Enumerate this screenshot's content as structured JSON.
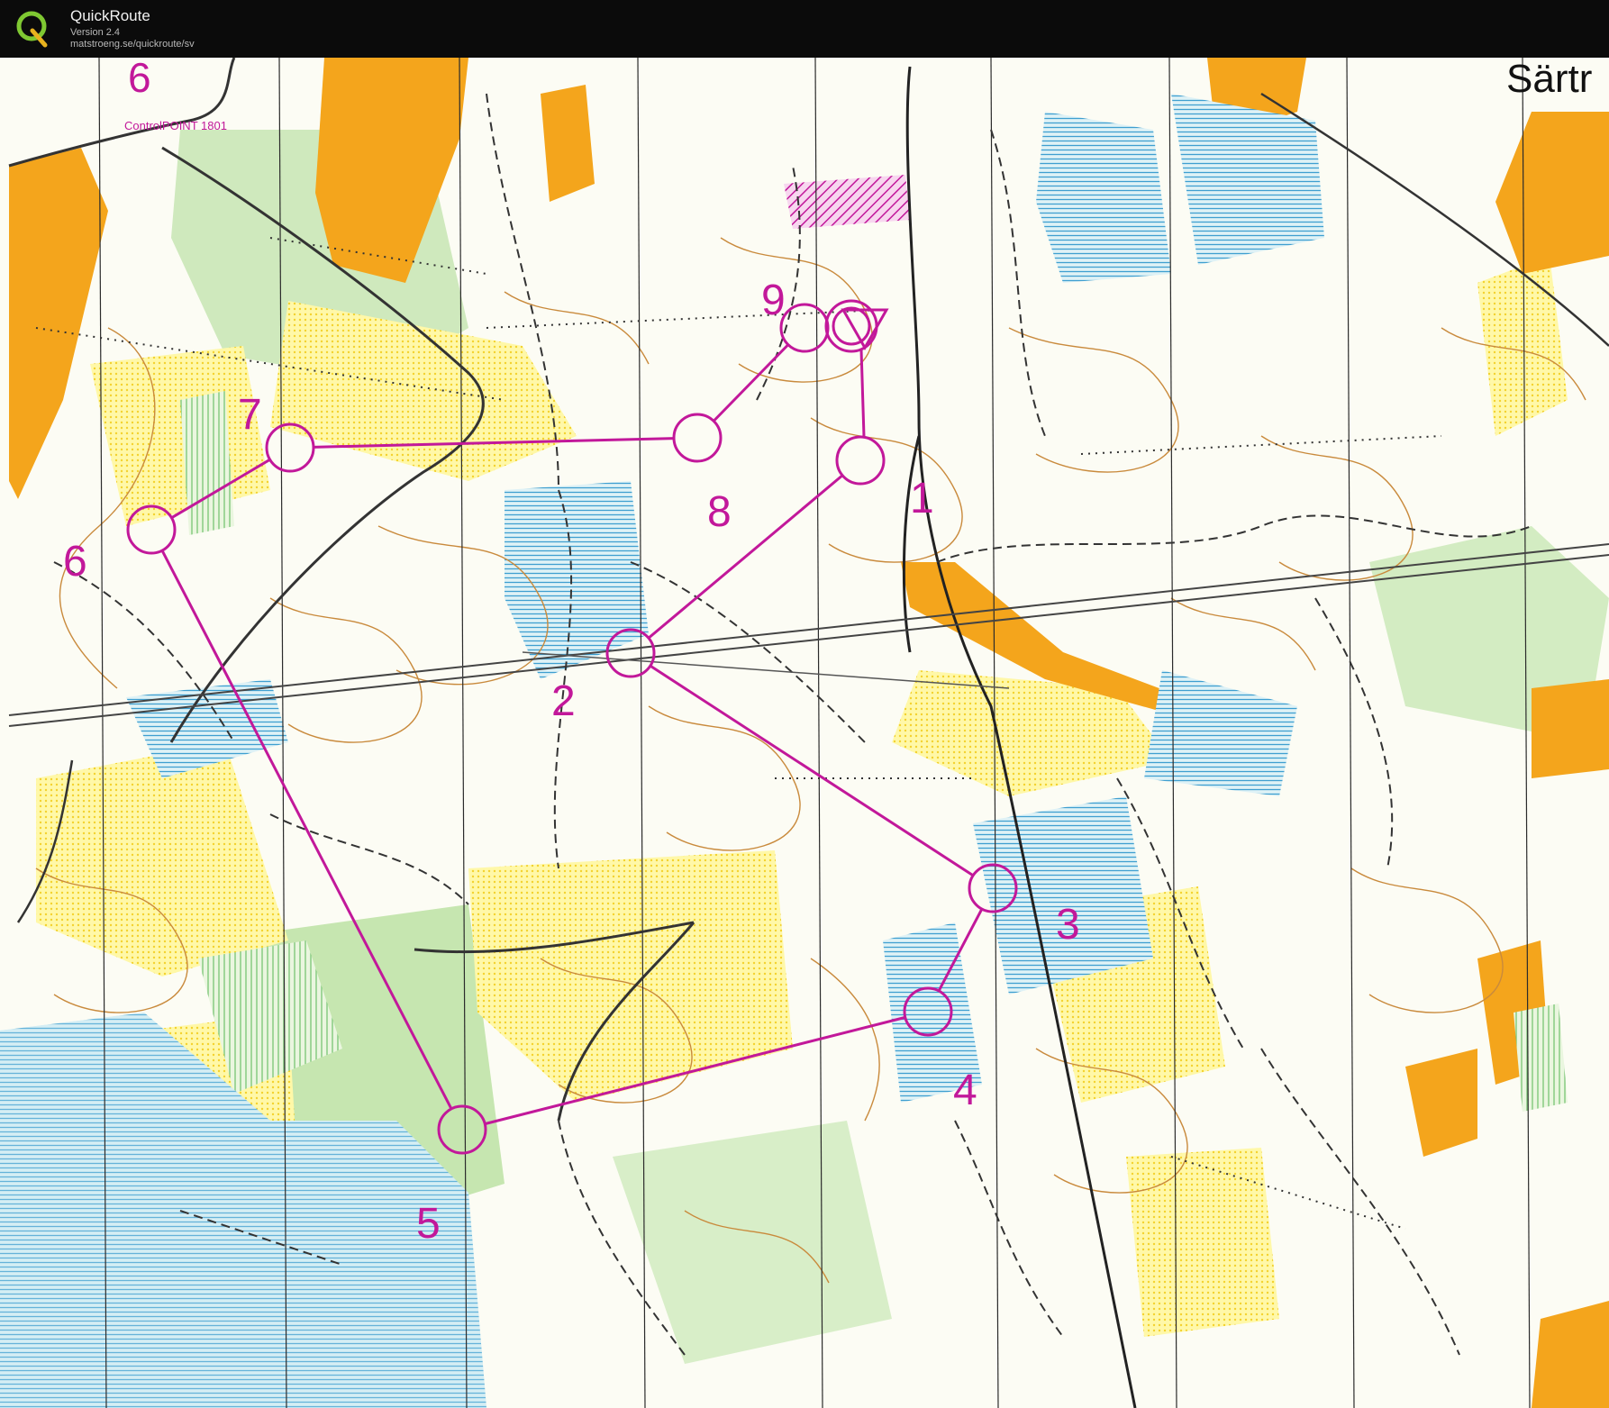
{
  "app": {
    "name": "QuickRoute",
    "version": "Version 2.4",
    "url": "matstroeng.se/quickroute/sv",
    "logo_letter": "Q"
  },
  "map": {
    "place_name": "Särtr",
    "map_note": "ControlPOINT 1801",
    "page_number": "6",
    "colors": {
      "course": "#c2189a",
      "field": "#f4a51c",
      "rough_open": "#fff27a",
      "forest_green": "#bfe3a6",
      "marsh_water": "#8ecfe6",
      "contour": "#c98a3c",
      "paths": "#222222",
      "magnetic_north": "#2b2b2b"
    },
    "controls": [
      {
        "label": "1"
      },
      {
        "label": "2"
      },
      {
        "label": "3"
      },
      {
        "label": "4"
      },
      {
        "label": "5"
      },
      {
        "label": "6"
      },
      {
        "label": "7"
      },
      {
        "label": "8"
      },
      {
        "label": "9"
      }
    ]
  }
}
